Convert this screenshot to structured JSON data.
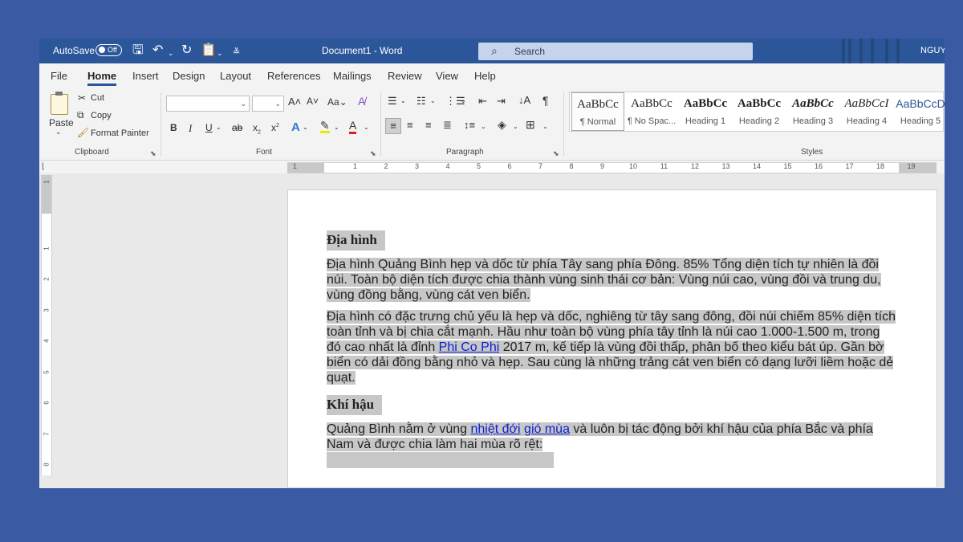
{
  "titlebar": {
    "autosave_label": "AutoSave",
    "autosave_state": "Off",
    "doc_title": "Document1  -  Word",
    "search_placeholder": "Search",
    "user": "NGUY"
  },
  "tabs": [
    "File",
    "Home",
    "Insert",
    "Design",
    "Layout",
    "References",
    "Mailings",
    "Review",
    "View",
    "Help"
  ],
  "active_tab": "Home",
  "ribbon": {
    "clipboard": {
      "paste": "Paste",
      "cut": "Cut",
      "copy": "Copy",
      "format_painter": "Format Painter",
      "label": "Clipboard"
    },
    "font": {
      "label": "Font"
    },
    "paragraph": {
      "label": "Paragraph"
    },
    "styles": {
      "label": "Styles",
      "items": [
        {
          "sample": "AaBbCc",
          "name": "¶ Normal"
        },
        {
          "sample": "AaBbCc",
          "name": "¶ No Spac..."
        },
        {
          "sample": "AaBbCc",
          "name": "Heading 1"
        },
        {
          "sample": "AaBbCc",
          "name": "Heading 2"
        },
        {
          "sample": "AaBbCc",
          "name": "Heading 3"
        },
        {
          "sample": "AaBbCcI",
          "name": "Heading 4"
        },
        {
          "sample": "AaBbCcD",
          "name": "Heading 5"
        }
      ]
    }
  },
  "ruler": {
    "numbers": [
      "1",
      "1",
      "2",
      "3",
      "4",
      "5",
      "6",
      "7",
      "8",
      "9",
      "10",
      "11",
      "12",
      "13",
      "14",
      "15",
      "16",
      "17",
      "18",
      "19"
    ],
    "vertical_numbers": [
      "1",
      "1",
      "2",
      "3",
      "4",
      "5",
      "6",
      "7",
      "8"
    ]
  },
  "document": {
    "heading1": "Địa hình",
    "para1": "Địa hình Quảng Bình hẹp và dốc từ phía Tây sang phía Đông. 85% Tổng diện tích tự nhiên là đồi núi. Toàn bộ diện tích được chia thành vùng sinh thái cơ bản: Vùng núi cao, vùng đồi và trung du, vùng đồng bằng, vùng cát ven biển.",
    "para2_before": "Địa hình có đặc trưng chủ yếu là hẹp và dốc, nghiêng từ tây sang đông, đồi núi chiếm 85% diện tích toàn tỉnh và bị chia cắt mạnh. Hầu như toàn bộ vùng phía tây tỉnh là núi cao 1.000-1.500 m, trong đó cao nhất là đỉnh ",
    "para2_link": "Phi Co Phi",
    "para2_after": " 2017 m, kế tiếp là vùng đồi thấp, phân bố theo kiểu bát úp. Gần bờ biển có dải đồng bằng nhỏ và hẹp. Sau cùng là những trảng cát ven biển có dạng lưỡi liềm hoặc dẻ quạt.",
    "heading2": "Khí hậu",
    "para3_before": "Quảng Bình nằm ở vùng ",
    "para3_link1": "nhiệt đới",
    "para3_link2": "gió mùa",
    "para3_after": " và luôn bị tác động bởi khí hậu của phía Bắc và phía Nam và được chia làm hai mùa rõ rệt:"
  }
}
